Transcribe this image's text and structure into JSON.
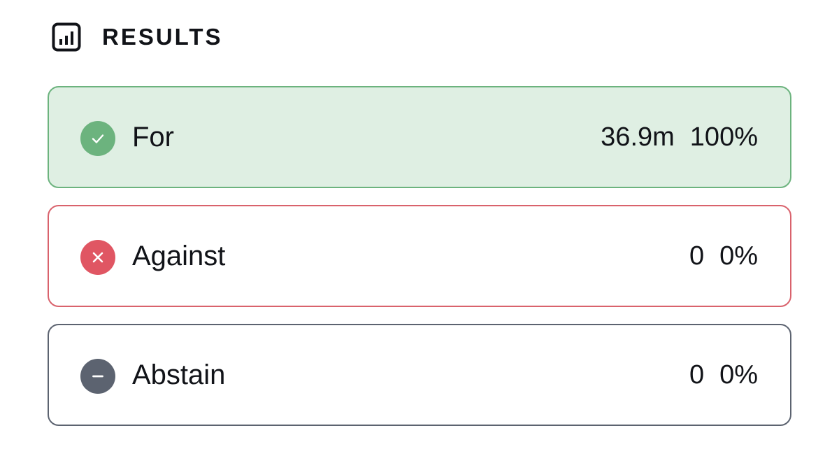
{
  "header": {
    "title": "RESULTS",
    "icon": "bar-chart-icon"
  },
  "options": {
    "for": {
      "label": "For",
      "count": "36.9m",
      "percent": "100%",
      "icon": "check-circle-icon",
      "border_color": "#6cb37e",
      "background_color": "#dfefe3",
      "icon_color": "#6cb37e"
    },
    "against": {
      "label": "Against",
      "count": "0",
      "percent": "0%",
      "icon": "x-circle-icon",
      "border_color": "#d9626c",
      "background_color": "#ffffff",
      "icon_color": "#e05663"
    },
    "abstain": {
      "label": "Abstain",
      "count": "0",
      "percent": "0%",
      "icon": "minus-circle-icon",
      "border_color": "#5c6370",
      "background_color": "#ffffff",
      "icon_color": "#5c6370"
    }
  }
}
